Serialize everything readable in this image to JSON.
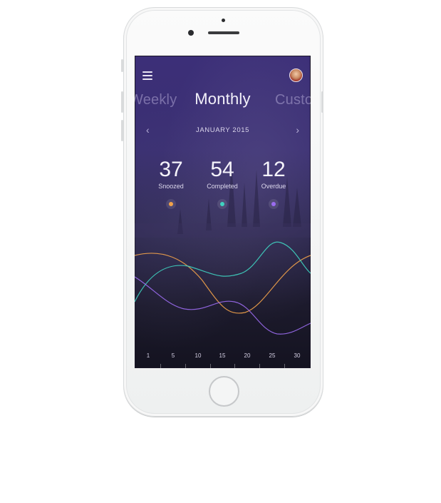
{
  "app": {
    "tabs": [
      {
        "label": "Weekly",
        "visible_text": "Weekly",
        "position": "left",
        "active": false
      },
      {
        "label": "Monthly",
        "active": true
      },
      {
        "label": "Custo",
        "position": "right",
        "active": false
      }
    ],
    "period": {
      "label": "JANUARY 2015",
      "prev_icon": "chevron-left-icon",
      "next_icon": "chevron-right-icon"
    },
    "menu_icon": "hamburger-menu-icon",
    "avatar_icon": "user-avatar",
    "stats": [
      {
        "value": "37",
        "label": "Snoozed",
        "color": "#f2a24a"
      },
      {
        "value": "54",
        "label": "Completed",
        "color": "#3fd2c0"
      },
      {
        "value": "12",
        "label": "Overdue",
        "color": "#9b6cf0"
      }
    ]
  },
  "chart_data": {
    "type": "line",
    "x_ticks": [
      "1",
      "5",
      "10",
      "15",
      "20",
      "25",
      "30"
    ],
    "series": [
      {
        "color": "#f2a24a"
      },
      {
        "color": "#3fd2c0"
      },
      {
        "color": "#9b6cf0"
      }
    ]
  }
}
